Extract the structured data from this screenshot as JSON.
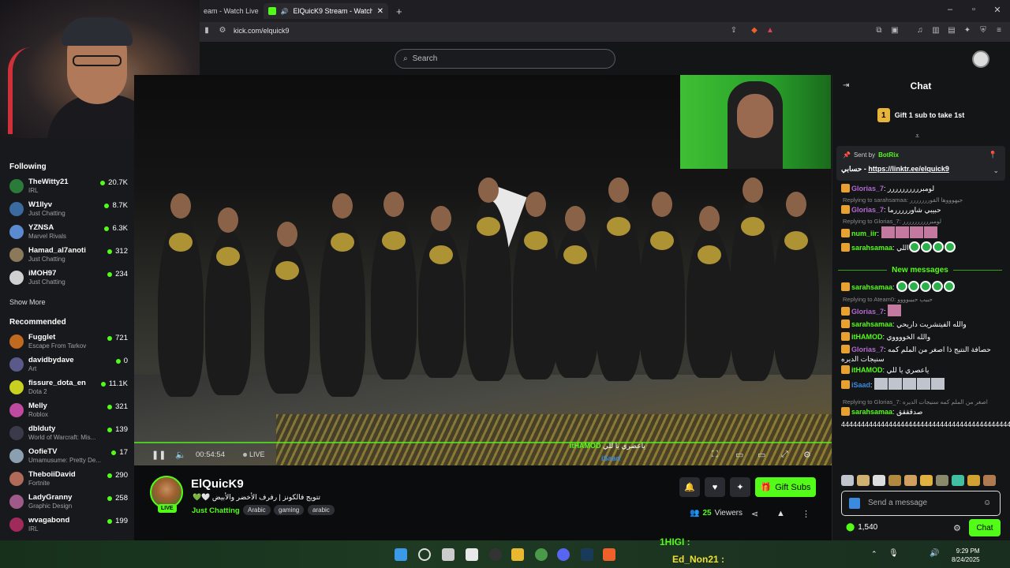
{
  "browser": {
    "tabs": [
      {
        "title": "eam - Watch Live"
      },
      {
        "title": "ElQuicK9 Stream - Watch Live"
      }
    ],
    "url": "kick.com/elquick9",
    "new_tab": "+"
  },
  "header": {
    "search_placeholder": "Search"
  },
  "sidebar": {
    "following_title": "Following",
    "following": [
      {
        "name": "TheWitty21",
        "category": "IRL",
        "viewers": "20.7K",
        "color": "#2a7a3a"
      },
      {
        "name": "W1llyv",
        "category": "Just Chatting",
        "viewers": "8.7K",
        "color": "#3a6aa0"
      },
      {
        "name": "YZNSA",
        "category": "Marvel Rivals",
        "viewers": "6.3K",
        "color": "#5a8ad0"
      },
      {
        "name": "Hamad_al7anoti",
        "category": "Just Chatting",
        "viewers": "312",
        "color": "#8a7a5a"
      },
      {
        "name": "iMOH97",
        "category": "Just Chatting",
        "viewers": "234",
        "color": "#d0d0d0"
      }
    ],
    "show_more": "Show More",
    "recommended_title": "Recommended",
    "recommended": [
      {
        "name": "Fugglet",
        "category": "Escape From Tarkov",
        "viewers": "721",
        "color": "#c06a20"
      },
      {
        "name": "davidbydave",
        "category": "Art",
        "viewers": "0",
        "color": "#5a5a8a"
      },
      {
        "name": "fissure_dota_en",
        "category": "Dota 2",
        "viewers": "11.1K",
        "color": "#c8d020"
      },
      {
        "name": "Melly",
        "category": "Roblox",
        "viewers": "321",
        "color": "#c04aa0"
      },
      {
        "name": "dblduty",
        "category": "World of Warcraft: Mis...",
        "viewers": "139",
        "color": "#3a3a4a"
      },
      {
        "name": "OofieTV",
        "category": "Umamusume: Pretty De...",
        "viewers": "17",
        "color": "#8aa0b0"
      },
      {
        "name": "TheboiiDavid",
        "category": "Fortnite",
        "viewers": "290",
        "color": "#b06a5a"
      },
      {
        "name": "LadyGranny",
        "category": "Graphic Design",
        "viewers": "258",
        "color": "#a05a8a"
      },
      {
        "name": "wvagabond",
        "category": "IRL",
        "viewers": "199",
        "color": "#a02a5a"
      }
    ]
  },
  "video": {
    "time": "00:54:54",
    "live_label": "LIVE",
    "overlay_user": "itHAMOD",
    "overlay_msg": "ياعصري يا للي",
    "overlay_user2": "iSaad"
  },
  "stream": {
    "channel": "ElQuicK9",
    "live": "LIVE",
    "title": "💚🤍 تتويج فالكونز | رفرف الأخضر والأبيض",
    "category": "Just Chatting",
    "tags": [
      "Arabic",
      "gaming",
      "arabic"
    ],
    "gift_subs": "Gift Subs",
    "viewers_count": "25",
    "viewers_label": "Viewers"
  },
  "chat": {
    "title": "Chat",
    "gift_banner": "Gift 1 sub to take 1st",
    "gift_rank": "1",
    "pinned": {
      "sent_by": "Sent by",
      "bot": "BotRix",
      "text_prefix": "حسابي -",
      "link": "https://linktr.ee/elquick9"
    },
    "messages": [
      {
        "user": "Glorias_7",
        "color": "#b06ad0",
        "text": "لومبرررررررررر"
      },
      {
        "reply": "Replying to sarahsamaa: جيهوووها القوررررررر"
      },
      {
        "user": "Glorias_7",
        "color": "#b06ad0",
        "text": "حبيبي شاورررررما"
      },
      {
        "reply": "Replying to Glorias_7: لومبرررررررررر"
      },
      {
        "user": "num_iir",
        "color": "#53fc18",
        "text": ""
      },
      {
        "user": "sarahsamaa",
        "color": "#53fc18",
        "text": "اللي"
      }
    ],
    "new_messages": "New messages",
    "messages2": [
      {
        "user": "sarahsamaa",
        "color": "#53fc18",
        "text": ""
      },
      {
        "reply": "Replying to Ateam0: حبيب حبيبوووو"
      },
      {
        "user": "Glorias_7",
        "color": "#b06ad0",
        "text": ""
      },
      {
        "user": "sarahsamaa",
        "color": "#53fc18",
        "text": "والله الفيتشريت داريحي"
      },
      {
        "user": "itHAMOD",
        "color": "#53fc18",
        "text": "والله الخووووي"
      },
      {
        "user": "Glorias_7",
        "color": "#b06ad0",
        "text": "حصافة النتيج ذا اصغر من الملم كمه سنيجات الديره"
      },
      {
        "user": "itHAMOD",
        "color": "#53fc18",
        "text": "ياعصري يا للي"
      },
      {
        "user": "iSaad",
        "color": "#3a8ae0",
        "text": ""
      },
      {
        "reply": "Replying to Glorias_7: اصغر من الملم كمه سنيجات الديره"
      },
      {
        "user": "sarahsamaa",
        "color": "#53fc18",
        "text": "صدقققق"
      },
      {
        "user": "",
        "color": "#fff",
        "text": "444444444444444444444444444444444444444444444444"
      }
    ],
    "input_placeholder": "Send a message",
    "points": "1,540",
    "send": "Chat"
  },
  "taskbar": {
    "time": "9:29 PM",
    "date": "8/24/2025",
    "overlay1": "1HIGI :",
    "overlay2": "Ed_Non21 :"
  }
}
